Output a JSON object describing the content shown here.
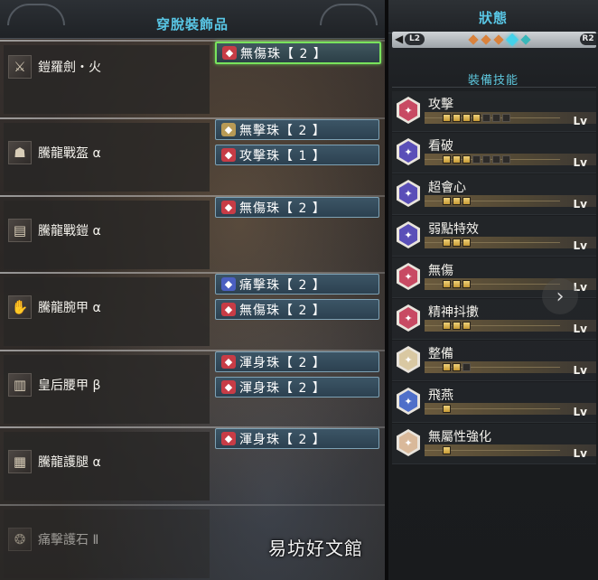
{
  "left_panel": {
    "title": "穿脫裝飾品",
    "rows": [
      {
        "icon": "sword-icon",
        "icon_glyph": "⚔",
        "name": "鎧羅劍・火",
        "decorations": [
          {
            "label": "無傷珠【 2 】",
            "gem_color": "#c73c46",
            "selected": true
          }
        ]
      },
      {
        "icon": "helmet-icon",
        "icon_glyph": "☗",
        "name": "騰龍戰盔 α",
        "decorations": [
          {
            "label": "無擊珠【 2 】",
            "gem_color": "#b89a55",
            "selected": false
          },
          {
            "label": "攻擊珠【 1 】",
            "gem_color": "#c73c46",
            "selected": false
          }
        ]
      },
      {
        "icon": "chest-armor-icon",
        "icon_glyph": "▤",
        "name": "騰龍戰鎧 α",
        "decorations": [
          {
            "label": "無傷珠【 2 】",
            "gem_color": "#c73c46",
            "selected": false
          }
        ]
      },
      {
        "icon": "gauntlet-icon",
        "icon_glyph": "✋",
        "name": "騰龍腕甲 α",
        "decorations": [
          {
            "label": "痛擊珠【 2 】",
            "gem_color": "#4a5fc1",
            "selected": false
          },
          {
            "label": "無傷珠【 2 】",
            "gem_color": "#c73c46",
            "selected": false
          }
        ]
      },
      {
        "icon": "waist-armor-icon",
        "icon_glyph": "▥",
        "name": "皇后腰甲 β",
        "decorations": [
          {
            "label": "渾身珠【 2 】",
            "gem_color": "#c73c46",
            "selected": false
          },
          {
            "label": "渾身珠【 2 】",
            "gem_color": "#c73c46",
            "selected": false
          }
        ]
      },
      {
        "icon": "leg-armor-icon",
        "icon_glyph": "▦",
        "name": "騰龍護腿 α",
        "decorations": [
          {
            "label": "渾身珠【 2 】",
            "gem_color": "#c73c46",
            "selected": false
          }
        ]
      },
      {
        "icon": "charm-icon",
        "icon_glyph": "❂",
        "name": "痛擊護石 Ⅱ",
        "decorations": []
      }
    ]
  },
  "right_panel": {
    "title": "狀態",
    "nav": {
      "left_button": "L2",
      "right_button": "R2",
      "left_arrow": "◀",
      "pages_total": 5,
      "active_page": 4
    },
    "skills_header": "裝備技能",
    "lv_label": "Lv",
    "next_arrow": "›",
    "skills": [
      {
        "name": "攻擊",
        "level": 4,
        "max": 7,
        "badge_color": "#c84a63"
      },
      {
        "name": "看破",
        "level": 3,
        "max": 7,
        "badge_color": "#5a4fb8"
      },
      {
        "name": "超會心",
        "level": 3,
        "max": 3,
        "badge_color": "#5a4fb8"
      },
      {
        "name": "弱點特效",
        "level": 3,
        "max": 3,
        "badge_color": "#5a4fb8"
      },
      {
        "name": "無傷",
        "level": 3,
        "max": 3,
        "badge_color": "#c84a63"
      },
      {
        "name": "精神抖擻",
        "level": 3,
        "max": 3,
        "badge_color": "#c84a63"
      },
      {
        "name": "整備",
        "level": 2,
        "max": 3,
        "badge_color": "#d9c8a2"
      },
      {
        "name": "飛燕",
        "level": 1,
        "max": 1,
        "badge_color": "#4f6fc9"
      },
      {
        "name": "無屬性強化",
        "level": 1,
        "max": 1,
        "badge_color": "#d9b99a"
      }
    ]
  },
  "watermark": "易坊好文館"
}
